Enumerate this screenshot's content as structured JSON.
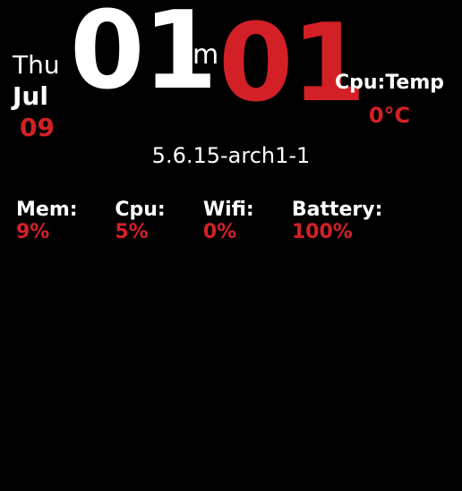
{
  "date": {
    "day_of_week": "Thu",
    "month": "Jul",
    "day_num": "09"
  },
  "time": {
    "hour": "01",
    "ampm": "pm",
    "minute": "01"
  },
  "cpu_temp": {
    "label": "Cpu:Temp",
    "value": "0°C"
  },
  "kernel": "5.6.15-arch1-1",
  "stats": {
    "mem": {
      "label": "Mem: ",
      "value": "9%"
    },
    "cpu": {
      "label": "Cpu: ",
      "value": "5%"
    },
    "wifi": {
      "label": "Wifi: ",
      "value": "0%"
    },
    "battery": {
      "label": "Battery: ",
      "value": "100%"
    }
  }
}
